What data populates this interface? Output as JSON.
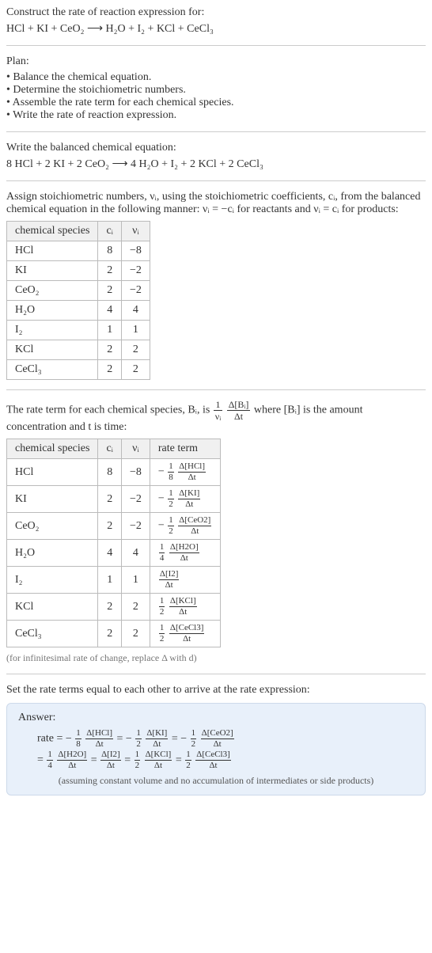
{
  "intro": {
    "line1": "Construct the rate of reaction expression for:",
    "equation_text": "HCl + KI + CeO₂  ⟶  H₂O + I₂ + KCl + CeCl₃"
  },
  "plan": {
    "title": "Plan:",
    "items": [
      "Balance the chemical equation.",
      "Determine the stoichiometric numbers.",
      "Assemble the rate term for each chemical species.",
      "Write the rate of reaction expression."
    ]
  },
  "balanced": {
    "title": "Write the balanced chemical equation:",
    "equation_text": "8 HCl + 2 KI + 2 CeO₂  ⟶  4 H₂O + I₂ + 2 KCl + 2 CeCl₃"
  },
  "stoich": {
    "intro": "Assign stoichiometric numbers, νᵢ, using the stoichiometric coefficients, cᵢ, from the balanced chemical equation in the following manner: νᵢ = −cᵢ for reactants and νᵢ = cᵢ for products:",
    "headers": [
      "chemical species",
      "cᵢ",
      "νᵢ"
    ],
    "rows": [
      {
        "species": "HCl",
        "c": "8",
        "v": "−8"
      },
      {
        "species": "KI",
        "c": "2",
        "v": "−2"
      },
      {
        "species": "CeO₂",
        "c": "2",
        "v": "−2"
      },
      {
        "species": "H₂O",
        "c": "4",
        "v": "4"
      },
      {
        "species": "I₂",
        "c": "1",
        "v": "1"
      },
      {
        "species": "KCl",
        "c": "2",
        "v": "2"
      },
      {
        "species": "CeCl₃",
        "c": "2",
        "v": "2"
      }
    ]
  },
  "rateterm": {
    "intro_a": "The rate term for each chemical species, Bᵢ, is ",
    "intro_b": " where [Bᵢ] is the amount concentration and t is time:",
    "headers": [
      "chemical species",
      "cᵢ",
      "νᵢ",
      "rate term"
    ],
    "rows": [
      {
        "species": "HCl",
        "c": "8",
        "v": "−8",
        "sign": "−",
        "coef_num": "1",
        "coef_den": "8",
        "delta": "Δ[HCl]"
      },
      {
        "species": "KI",
        "c": "2",
        "v": "−2",
        "sign": "−",
        "coef_num": "1",
        "coef_den": "2",
        "delta": "Δ[KI]"
      },
      {
        "species": "CeO₂",
        "c": "2",
        "v": "−2",
        "sign": "−",
        "coef_num": "1",
        "coef_den": "2",
        "delta": "Δ[CeO2]"
      },
      {
        "species": "H₂O",
        "c": "4",
        "v": "4",
        "sign": "",
        "coef_num": "1",
        "coef_den": "4",
        "delta": "Δ[H2O]"
      },
      {
        "species": "I₂",
        "c": "1",
        "v": "1",
        "sign": "",
        "coef_num": "",
        "coef_den": "",
        "delta": "Δ[I2]"
      },
      {
        "species": "KCl",
        "c": "2",
        "v": "2",
        "sign": "",
        "coef_num": "1",
        "coef_den": "2",
        "delta": "Δ[KCl]"
      },
      {
        "species": "CeCl₃",
        "c": "2",
        "v": "2",
        "sign": "",
        "coef_num": "1",
        "coef_den": "2",
        "delta": "Δ[CeCl3]"
      }
    ],
    "note": "(for infinitesimal rate of change, replace Δ with d)"
  },
  "final": {
    "intro": "Set the rate terms equal to each other to arrive at the rate expression:",
    "answer_label": "Answer:",
    "rate_label": "rate = ",
    "eq_label": "= ",
    "terms_line1": [
      {
        "sign": "−",
        "num": "1",
        "den": "8",
        "delta": "Δ[HCl]"
      },
      {
        "sign": "−",
        "num": "1",
        "den": "2",
        "delta": "Δ[KI]"
      },
      {
        "sign": "−",
        "num": "1",
        "den": "2",
        "delta": "Δ[CeO2]"
      }
    ],
    "terms_line2": [
      {
        "sign": "",
        "num": "1",
        "den": "4",
        "delta": "Δ[H2O]"
      },
      {
        "sign": "",
        "num": "",
        "den": "",
        "delta": "Δ[I2]"
      },
      {
        "sign": "",
        "num": "1",
        "den": "2",
        "delta": "Δ[KCl]"
      },
      {
        "sign": "",
        "num": "1",
        "den": "2",
        "delta": "Δ[CeCl3]"
      }
    ],
    "assumption": "(assuming constant volume and no accumulation of intermediates or side products)"
  }
}
